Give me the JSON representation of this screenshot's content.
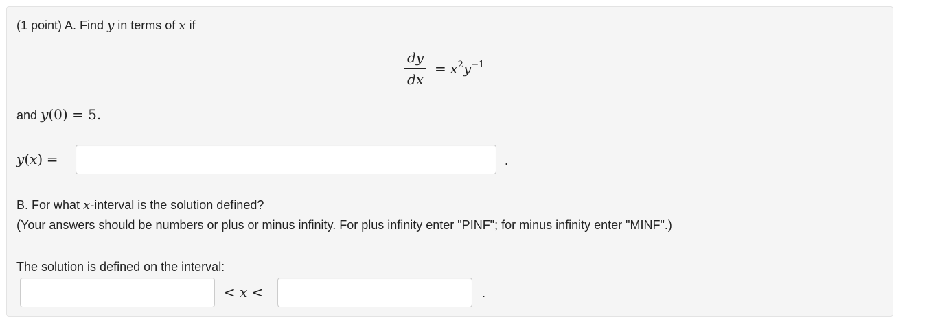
{
  "partA": {
    "intro": "(1 point) A. Find",
    "var_y": "y",
    "in_terms_of": "in terms of",
    "var_x": "x",
    "if": "if",
    "equation": {
      "numerator": "dy",
      "denominator": "dx",
      "equals": "=",
      "rhs_x": "x",
      "rhs_x_exp": "2",
      "rhs_y": "y",
      "rhs_y_exp": "−1"
    },
    "initial_prefix": "and",
    "initial_condition_fn": "y",
    "initial_condition_rest": "(0) = 5.",
    "answer_label_fn": "y",
    "answer_label_arg": "(x)",
    "answer_label_eq": "=",
    "answer_value": "",
    "answer_suffix": "."
  },
  "partB": {
    "question_prefix": "B. For what",
    "question_var": "x",
    "question_suffix": "-interval is the solution defined?",
    "instructions": "(Your answers should be numbers or plus or minus infinity. For plus infinity enter \"PINF\"; for minus infinity enter \"MINF\".)",
    "interval_label": "The solution is defined on the interval:",
    "lower_value": "",
    "inequality": "< x <",
    "upper_value": "",
    "suffix": "."
  }
}
